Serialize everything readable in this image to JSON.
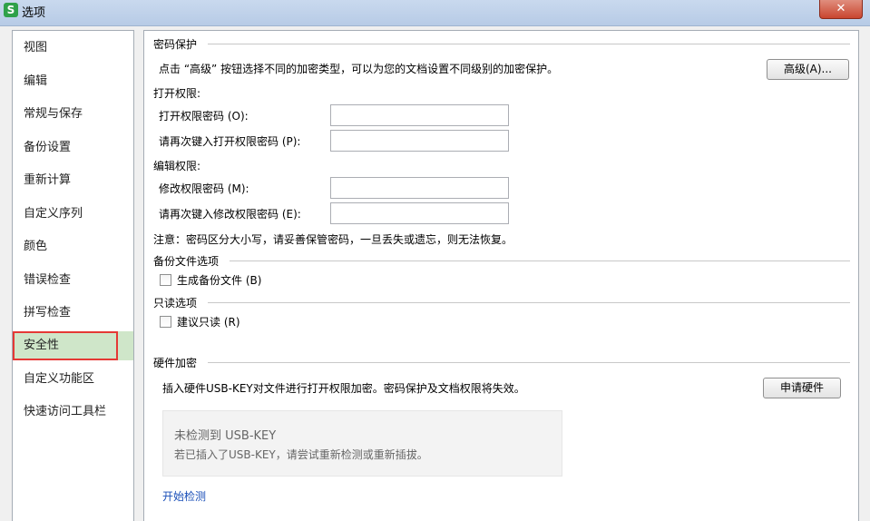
{
  "window": {
    "title": "选项",
    "logo": "S",
    "close": "✕"
  },
  "sidebar": {
    "items": [
      {
        "label": "视图"
      },
      {
        "label": "编辑"
      },
      {
        "label": "常规与保存"
      },
      {
        "label": "备份设置"
      },
      {
        "label": "重新计算"
      },
      {
        "label": "自定义序列"
      },
      {
        "label": "颜色"
      },
      {
        "label": "错误检查"
      },
      {
        "label": "拼写检查"
      },
      {
        "label": "安全性",
        "selected": true
      },
      {
        "label": "自定义功能区"
      },
      {
        "label": "快速访问工具栏"
      }
    ]
  },
  "password_protection": {
    "title": "密码保护",
    "description": "点击 “高级” 按钮选择不同的加密类型，可以为您的文档设置不同级别的加密保护。",
    "advanced_button": "高级(A)...",
    "open_perm": {
      "title": "打开权限:",
      "open_password_label": "打开权限密码 (O):",
      "open_password_value": "",
      "reenter_open_label": "请再次键入打开权限密码 (P):",
      "reenter_open_value": ""
    },
    "edit_perm": {
      "title": "编辑权限:",
      "modify_password_label": "修改权限密码 (M):",
      "modify_password_value": "",
      "reenter_modify_label": "请再次键入修改权限密码 (E):",
      "reenter_modify_value": ""
    },
    "note": "注意：密码区分大小写，请妥善保管密码，一旦丢失或遗忘，则无法恢复。"
  },
  "backup_options": {
    "title": "备份文件选项",
    "generate_backup": {
      "label": "生成备份文件 (B)",
      "checked": false
    }
  },
  "readonly_options": {
    "title": "只读选项",
    "recommend_readonly": {
      "label": "建议只读 (R)",
      "checked": false
    }
  },
  "hardware_encryption": {
    "title": "硬件加密",
    "description": "插入硬件USB-KEY对文件进行打开权限加密。密码保护及文档权限将失效。",
    "apply_button": "申请硬件",
    "status_title": "未检测到 USB-KEY",
    "status_hint": "若已插入了USB-KEY，请尝试重新检测或重新插拔。",
    "start_detect_link": "开始检测"
  }
}
